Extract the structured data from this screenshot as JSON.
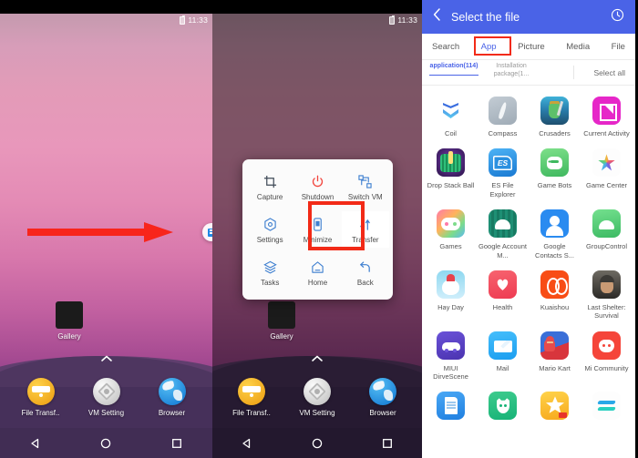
{
  "phone_left": {
    "status": {
      "time": "11:33",
      "battery_icon": "battery-icon"
    },
    "home_app": {
      "label": "Gallery",
      "icon": "gallery-icon"
    },
    "drawer_indicator": "chevron-up-icon",
    "dock": [
      {
        "label": "File Transf..",
        "icon": "file-transfer-icon"
      },
      {
        "label": "VM Setting",
        "icon": "vm-setting-icon"
      },
      {
        "label": "Browser",
        "icon": "browser-icon"
      }
    ],
    "navbar": [
      {
        "name": "back",
        "icon": "triangle-back-icon"
      },
      {
        "name": "home",
        "icon": "circle-home-icon"
      },
      {
        "name": "recents",
        "icon": "square-recents-icon"
      }
    ],
    "floating_bubble": {
      "icon": "vm-tools-bubble-icon"
    },
    "annotation_arrow": {
      "icon": "red-arrow-icon",
      "color": "#f22a17"
    }
  },
  "phone_mid": {
    "status": {
      "time": "11:33",
      "battery_icon": "battery-icon"
    },
    "home_app": {
      "label": "Gallery",
      "icon": "gallery-icon"
    },
    "drawer_indicator": "chevron-up-icon",
    "dock": [
      {
        "label": "File Transf..",
        "icon": "file-transfer-icon"
      },
      {
        "label": "VM Setting",
        "icon": "vm-setting-icon"
      },
      {
        "label": "Browser",
        "icon": "browser-icon"
      }
    ],
    "navbar": [
      {
        "name": "back",
        "icon": "triangle-back-icon"
      },
      {
        "name": "home",
        "icon": "circle-home-icon"
      },
      {
        "name": "recents",
        "icon": "square-recents-icon"
      }
    ],
    "floating_menu": {
      "items": [
        {
          "label": "Capture",
          "icon": "crop-capture-icon",
          "highlighted": false
        },
        {
          "label": "Shutdown",
          "icon": "power-icon",
          "highlighted": false
        },
        {
          "label": "Switch VM",
          "icon": "switch-vm-icon",
          "highlighted": false
        },
        {
          "label": "Settings",
          "icon": "gear-hex-icon",
          "highlighted": false
        },
        {
          "label": "Minimize",
          "icon": "phone-minimize-icon",
          "highlighted": false
        },
        {
          "label": "Transfer",
          "icon": "transfer-arrows-icon",
          "highlighted": true
        },
        {
          "label": "Tasks",
          "icon": "layers-tasks-icon",
          "highlighted": false
        },
        {
          "label": "Home",
          "icon": "house-home-icon",
          "highlighted": false
        },
        {
          "label": "Back",
          "icon": "back-arrow-icon",
          "highlighted": false
        }
      ],
      "highlight_color": "#f22a17"
    }
  },
  "picker": {
    "header": {
      "back_icon": "chevron-left-icon",
      "title": "Select the file",
      "history_icon": "history-clock-icon",
      "background": "#4a63e7"
    },
    "tabs": [
      {
        "label": "Search",
        "active": false
      },
      {
        "label": "App",
        "active": true
      },
      {
        "label": "Picture",
        "active": false
      },
      {
        "label": "Media",
        "active": false
      },
      {
        "label": "File",
        "active": false
      }
    ],
    "tab_highlight_color": "#f22a17",
    "subtabs": [
      {
        "label": "application(114)",
        "active": true
      },
      {
        "label": "Installation package(1...",
        "active": false
      }
    ],
    "select_all": "Select all",
    "apps": [
      {
        "name": "Coil",
        "icon": "coil-icon"
      },
      {
        "name": "Compass",
        "icon": "compass-icon"
      },
      {
        "name": "Crusaders",
        "icon": "crusaders-icon"
      },
      {
        "name": "Current Activity",
        "icon": "current-activity-icon"
      },
      {
        "name": "Drop Stack Ball",
        "icon": "drop-stack-ball-icon"
      },
      {
        "name": "ES File Explorer",
        "icon": "es-file-explorer-icon"
      },
      {
        "name": "Game Bots",
        "icon": "game-bots-icon"
      },
      {
        "name": "Game Center",
        "icon": "game-center-icon"
      },
      {
        "name": "Games",
        "icon": "games-icon"
      },
      {
        "name": "Google Account M...",
        "icon": "google-account-manager-icon"
      },
      {
        "name": "Google Contacts S...",
        "icon": "google-contacts-sync-icon"
      },
      {
        "name": "GroupControl",
        "icon": "group-control-icon"
      },
      {
        "name": "Hay Day",
        "icon": "hay-day-icon"
      },
      {
        "name": "Health",
        "icon": "health-icon"
      },
      {
        "name": "Kuaishou",
        "icon": "kuaishou-icon"
      },
      {
        "name": "Last Shelter: Survival",
        "icon": "last-shelter-survival-icon"
      },
      {
        "name": "MIUI DirveScene",
        "icon": "miui-drivescene-icon"
      },
      {
        "name": "Mail",
        "icon": "mail-icon"
      },
      {
        "name": "Mario Kart",
        "icon": "mario-kart-icon"
      },
      {
        "name": "Mi Community",
        "icon": "mi-community-icon"
      },
      {
        "name": "",
        "icon": "document-icon"
      },
      {
        "name": "",
        "icon": "cat-icon"
      },
      {
        "name": "",
        "icon": "star-icon"
      },
      {
        "name": "",
        "icon": "swap-icon"
      }
    ]
  }
}
